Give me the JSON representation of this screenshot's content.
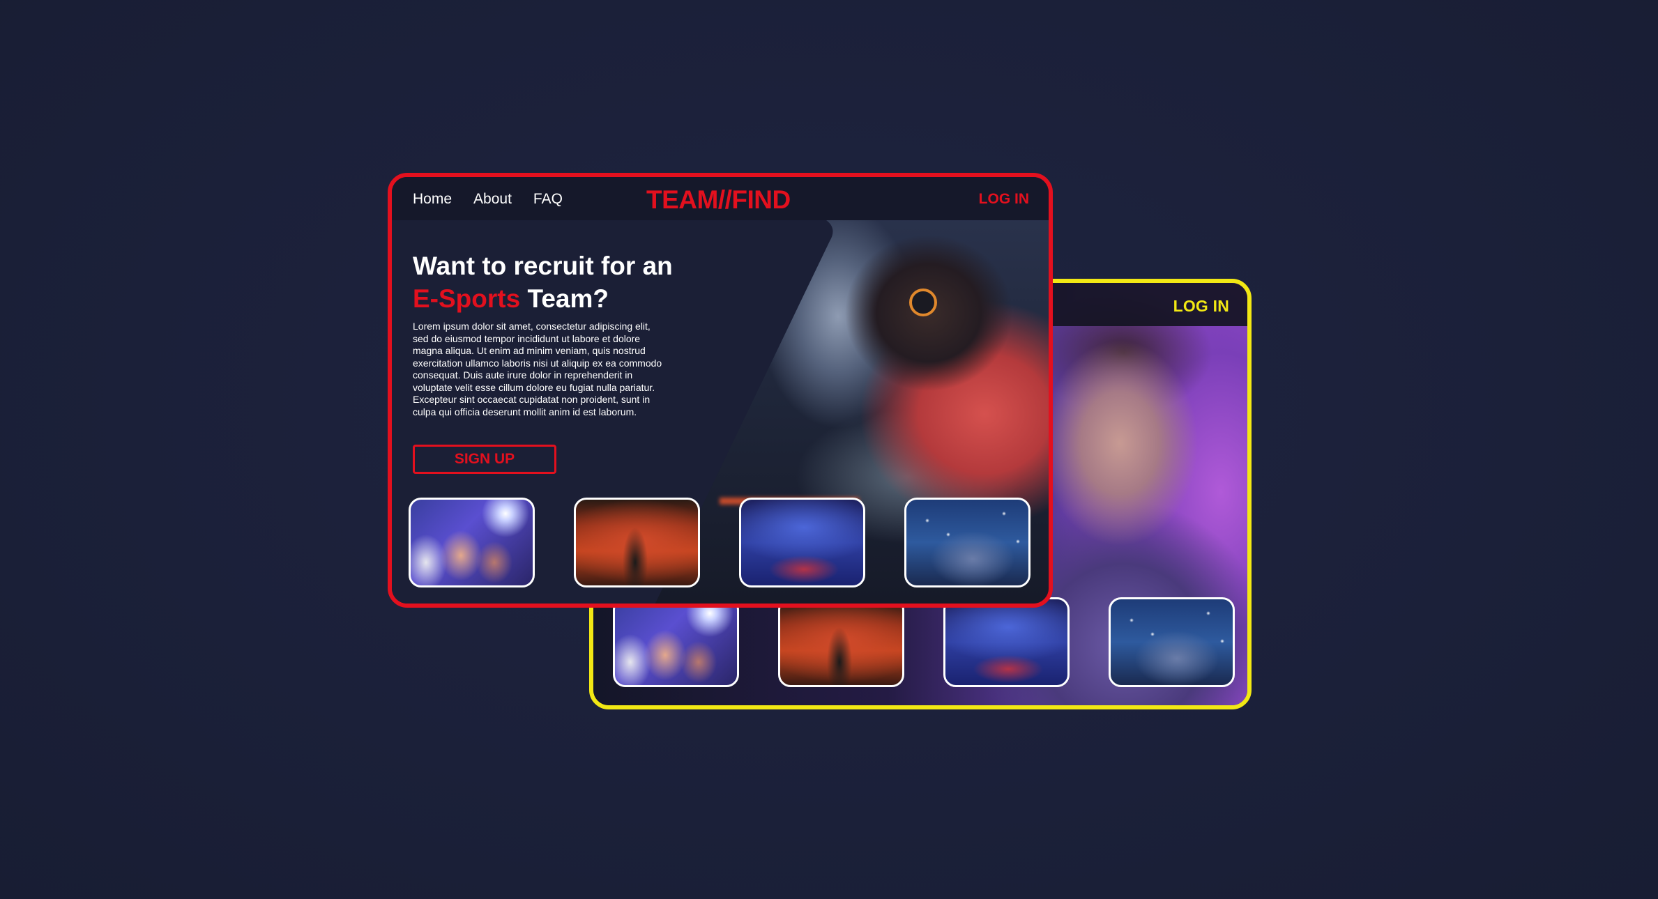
{
  "colors": {
    "background": "#1b2039",
    "primary_accent": "#e3101e",
    "secondary_accent": "#f2e814",
    "text": "#ffffff"
  },
  "front_card": {
    "nav": {
      "items": [
        {
          "label": "Home"
        },
        {
          "label": "About"
        },
        {
          "label": "FAQ"
        }
      ]
    },
    "logo": "TEAM//FIND",
    "login_label": "LOG IN",
    "hero": {
      "headline_start": "Want to recruit for an ",
      "headline_accent": "E-Sports",
      "headline_end": " Team?",
      "body": "Lorem ipsum dolor sit amet, consectetur adipiscing elit, sed do eiusmod tempor incididunt ut labore et dolore magna aliqua. Ut enim ad minim veniam, quis nostrud exercitation ullamco laboris nisi ut aliquip ex ea commodo consequat. Duis aute irure dolor in reprehenderit in voluptate velit esse cillum dolore eu fugiat nulla pariatur. Excepteur sint occaecat cupidatat non proident, sunt in culpa qui officia deserunt mollit anim id est laborum.",
      "signup_label": "SIGN UP"
    },
    "thumbnails": [
      {
        "icon": "gamers-photo"
      },
      {
        "icon": "crowd-photo"
      },
      {
        "icon": "arena-photo"
      },
      {
        "icon": "trophy-photo"
      }
    ]
  },
  "back_card": {
    "login_label": "LOG IN",
    "thumbnails": [
      {
        "icon": "gamers-photo"
      },
      {
        "icon": "crowd-photo"
      },
      {
        "icon": "arena-photo"
      },
      {
        "icon": "trophy-photo"
      }
    ]
  }
}
